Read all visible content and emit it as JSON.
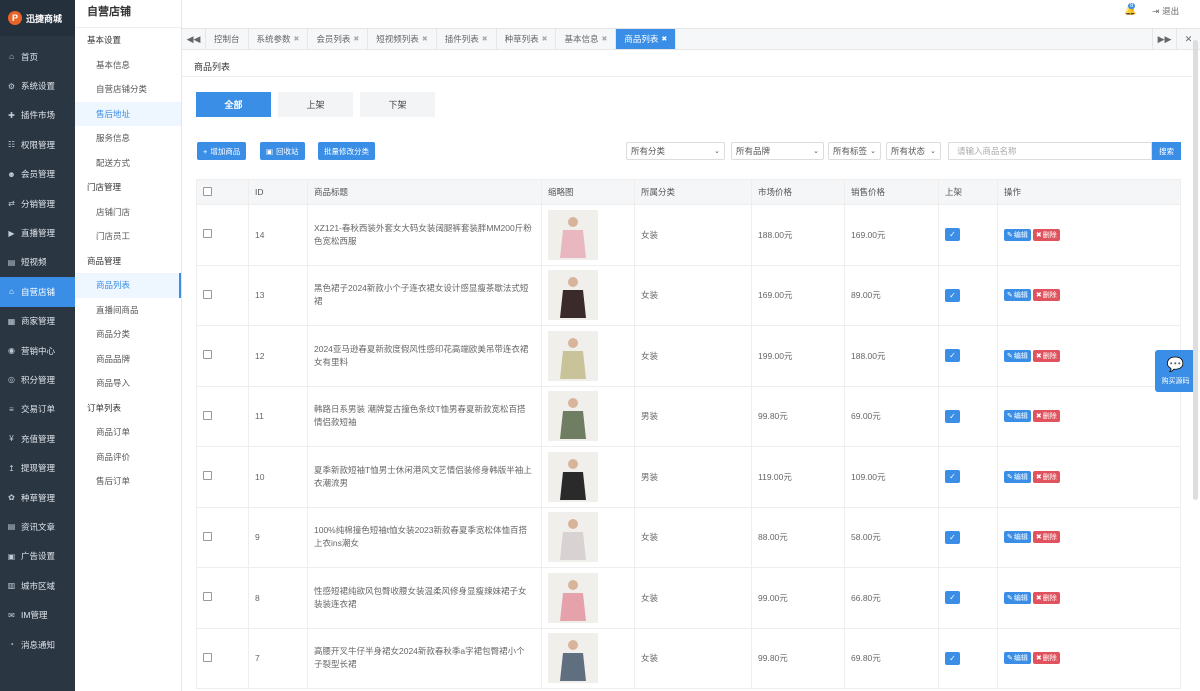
{
  "brand": {
    "mark": "P",
    "name": "迅捷商城"
  },
  "header": {
    "badge": "8",
    "logout": "退出"
  },
  "nav": [
    {
      "label": "首页",
      "icon": "home-icon"
    },
    {
      "label": "系统设置",
      "icon": "gear-icon"
    },
    {
      "label": "插件市场",
      "icon": "puzzle-icon"
    },
    {
      "label": "权限管理",
      "icon": "sitemap-icon"
    },
    {
      "label": "会员管理",
      "icon": "users-icon"
    },
    {
      "label": "分销管理",
      "icon": "share-icon"
    },
    {
      "label": "直播管理",
      "icon": "video-icon"
    },
    {
      "label": "短视频",
      "icon": "film-icon"
    },
    {
      "label": "自营店铺",
      "icon": "store-icon"
    },
    {
      "label": "商家管理",
      "icon": "shop-icon"
    },
    {
      "label": "营销中心",
      "icon": "bullhorn-icon"
    },
    {
      "label": "积分管理",
      "icon": "coin-icon"
    },
    {
      "label": "交易订单",
      "icon": "order-icon"
    },
    {
      "label": "充值管理",
      "icon": "yen-icon"
    },
    {
      "label": "提现管理",
      "icon": "withdraw-icon"
    },
    {
      "label": "种草管理",
      "icon": "leaf-icon"
    },
    {
      "label": "资讯文章",
      "icon": "article-icon"
    },
    {
      "label": "广告设置",
      "icon": "image-icon"
    },
    {
      "label": "城市区域",
      "icon": "city-icon"
    },
    {
      "label": "IM管理",
      "icon": "chat-icon"
    },
    {
      "label": "消息通知",
      "icon": "bell-icon"
    }
  ],
  "subnav": {
    "title": "自营店铺",
    "groups": [
      {
        "label": "基本设置",
        "items": [
          "基本信息",
          "自营店铺分类",
          "售后地址",
          "服务信息",
          "配送方式"
        ]
      },
      {
        "label": "门店管理",
        "items": [
          "店铺门店",
          "门店员工"
        ]
      },
      {
        "label": "商品管理",
        "items": [
          "商品列表",
          "直播间商品",
          "商品分类",
          "商品品牌",
          "商品导入"
        ]
      },
      {
        "label": "订单列表",
        "items": [
          "商品订单",
          "商品评价",
          "售后订单"
        ]
      }
    ]
  },
  "tabs": [
    "控制台",
    "系统参数",
    "会员列表",
    "短视频列表",
    "插件列表",
    "种草列表",
    "基本信息",
    "商品列表"
  ],
  "page": {
    "title": "商品列表",
    "filter_tabs": [
      "全部",
      "上架",
      "下架"
    ],
    "buttons": {
      "add": "增加商品",
      "recycle": "回收站",
      "batch": "批量修改分类"
    },
    "selects": [
      "所有分类",
      "所有品牌",
      "所有标签",
      "所有状态"
    ],
    "search_placeholder": "请输入商品名称",
    "search_btn": "搜索"
  },
  "table": {
    "headers": [
      "ID",
      "商品标题",
      "缩略图",
      "所属分类",
      "市场价格",
      "销售价格",
      "上架",
      "操作"
    ],
    "edit": "编辑",
    "del": "删除",
    "rows": [
      {
        "id": "14",
        "title": "XZ121-春秋西装外套女大码女装阔腿裤套装胖MM200斤粉色宽松西服",
        "cat": "女装",
        "market": "188.00元",
        "sale": "169.00元",
        "thumb": "#e8b7c0"
      },
      {
        "id": "13",
        "title": "黑色裙子2024新款小个子连衣裙女设计感显瘦茶歇法式短裙",
        "cat": "女装",
        "market": "169.00元",
        "sale": "89.00元",
        "thumb": "#3a2a2a"
      },
      {
        "id": "12",
        "title": "2024亚马逊春夏新款度假风性感印花高端欧美吊带连衣裙女有里料",
        "cat": "女装",
        "market": "199.00元",
        "sale": "188.00元",
        "thumb": "#c9c39a"
      },
      {
        "id": "11",
        "title": "韩路日系男装 潮牌复古撞色条纹T恤男春夏新款宽松百搭情侣款短袖",
        "cat": "男装",
        "market": "99.80元",
        "sale": "69.00元",
        "thumb": "#6f7d62"
      },
      {
        "id": "10",
        "title": "夏季新款短袖T恤男士休闲港风文艺情侣装修身韩版半袖上衣潮流男",
        "cat": "男装",
        "market": "119.00元",
        "sale": "109.00元",
        "thumb": "#2a2a2a"
      },
      {
        "id": "9",
        "title": "100%纯棉撞色短袖t恤女装2023新款春夏季宽松体恤百搭上衣ins潮女",
        "cat": "女装",
        "market": "88.00元",
        "sale": "58.00元",
        "thumb": "#d9d2d2"
      },
      {
        "id": "8",
        "title": "性感短裙纯欲风包臀收腰女装温柔风修身显瘦辣妹裙子女装装连衣裙",
        "cat": "女装",
        "market": "99.00元",
        "sale": "66.80元",
        "thumb": "#e6a2ab"
      },
      {
        "id": "7",
        "title": "高腰开叉牛仔半身裙女2024新款春秋季a字裙包臀裙小个子裂型长裙",
        "cat": "女装",
        "market": "99.80元",
        "sale": "69.80元",
        "thumb": "#5f6f80"
      }
    ]
  },
  "float_widget": {
    "label": "购买源码"
  }
}
